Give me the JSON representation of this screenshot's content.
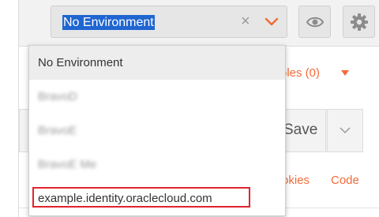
{
  "environment": {
    "selected_label": "No Environment",
    "clear_icon": "×",
    "options": [
      {
        "label": "No Environment"
      },
      {
        "label": "BravoD"
      },
      {
        "label": "BravoE"
      },
      {
        "label": "BravoE Me"
      },
      {
        "label": "example.identity.oraclecloud.com"
      }
    ]
  },
  "request": {
    "examples_label": "ples (0)",
    "save_label": "Save",
    "cookies_label": "okies",
    "code_label": "Code"
  },
  "colors": {
    "accent_orange": "#f26b3a",
    "selection_blue": "#1f66d1",
    "highlight_red": "#e0242d"
  },
  "icons": [
    "eye-icon",
    "gear-icon",
    "chevron-down-icon",
    "close-icon",
    "caret-down-icon"
  ]
}
